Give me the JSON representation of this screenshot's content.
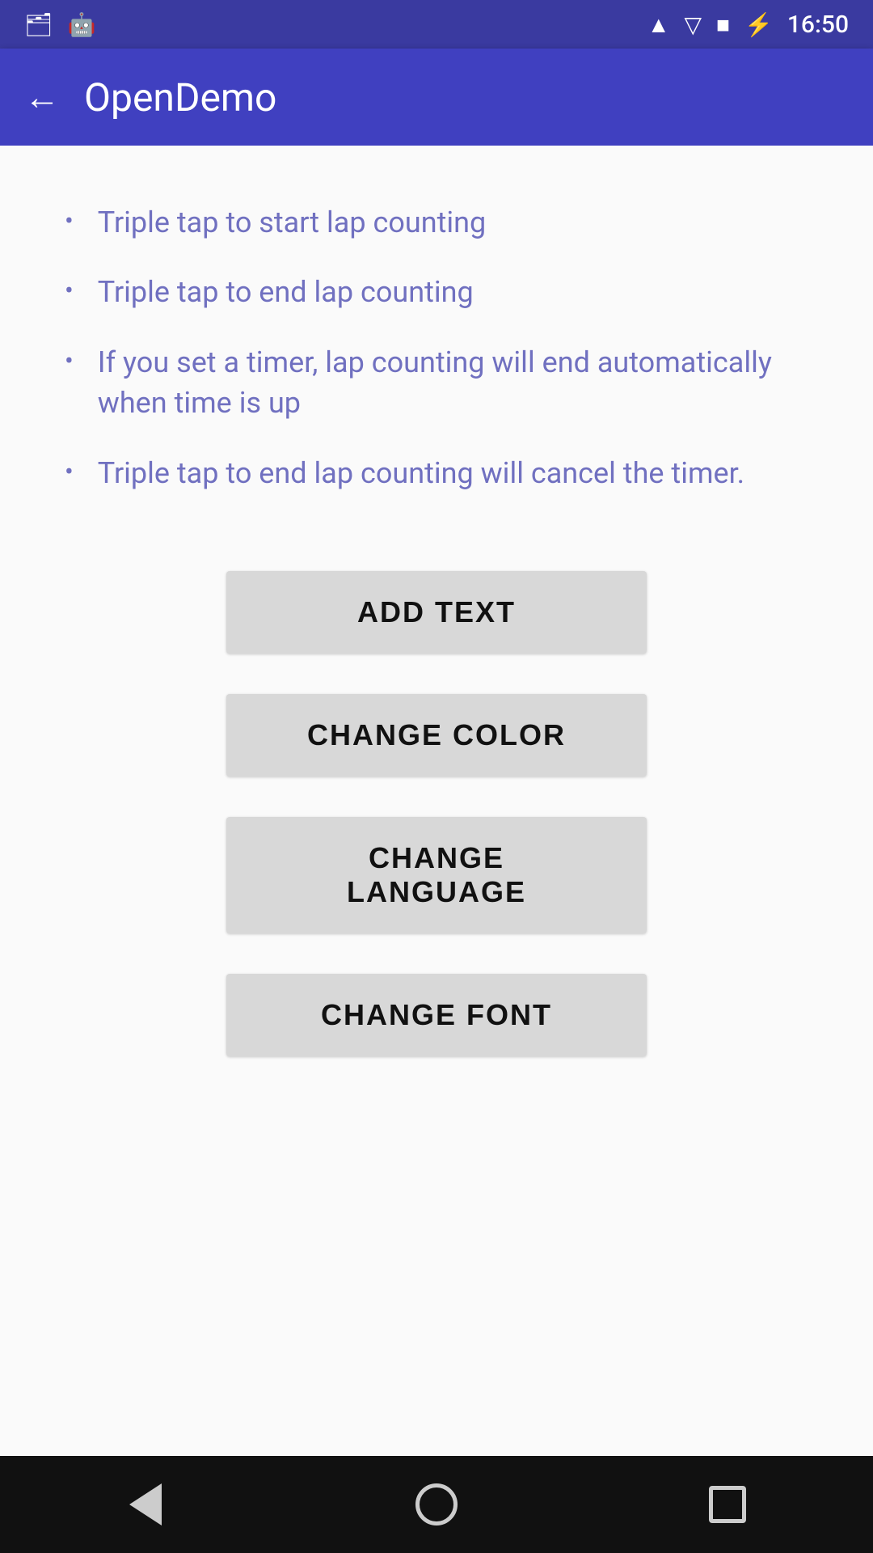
{
  "statusBar": {
    "time": "16:50",
    "leftIcons": [
      "sim-icon",
      "android-icon"
    ],
    "rightIcons": [
      "bluetooth-icon",
      "wifi-icon",
      "signal-icon",
      "battery-icon"
    ]
  },
  "appBar": {
    "title": "OpenDemo",
    "backLabel": "←"
  },
  "instructions": {
    "items": [
      "Triple tap to start lap counting",
      "Triple tap to end lap counting",
      "If you set a timer, lap counting will end automatically when time is up",
      "Triple tap to end lap counting will cancel the timer."
    ]
  },
  "buttons": {
    "addText": "ADD TEXT",
    "changeColor": "CHANGE COLOR",
    "changeLanguage": "CHANGE LANGUAGE",
    "changeFont": "CHANGE FONT"
  },
  "navBar": {
    "back": "back-nav",
    "home": "home-nav",
    "recents": "recents-nav"
  }
}
